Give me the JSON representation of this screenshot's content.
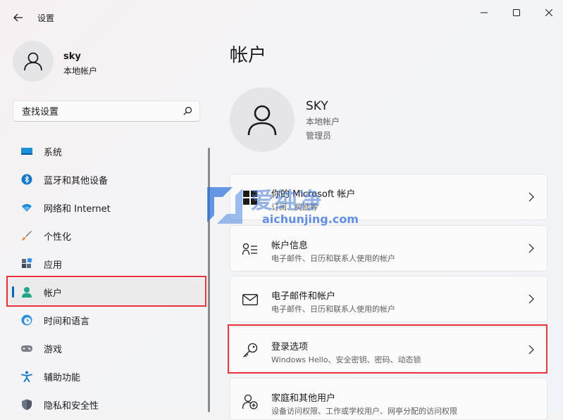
{
  "app": {
    "title": "设置"
  },
  "profile": {
    "name": "sky",
    "type": "本地帐户"
  },
  "search": {
    "placeholder": "查找设置"
  },
  "nav": {
    "items": [
      {
        "label": "系统",
        "icon": "monitor-icon"
      },
      {
        "label": "蓝牙和其他设备",
        "icon": "bluetooth-icon"
      },
      {
        "label": "网络和 Internet",
        "icon": "wifi-icon"
      },
      {
        "label": "个性化",
        "icon": "brush-icon"
      },
      {
        "label": "应用",
        "icon": "apps-icon"
      },
      {
        "label": "帐户",
        "icon": "person-icon",
        "active": true
      },
      {
        "label": "时间和语言",
        "icon": "globe-clock-icon"
      },
      {
        "label": "游戏",
        "icon": "gamepad-icon"
      },
      {
        "label": "辅助功能",
        "icon": "accessibility-icon"
      },
      {
        "label": "隐私和安全性",
        "icon": "shield-icon"
      }
    ]
  },
  "main": {
    "title": "帐户",
    "account": {
      "name": "SKY",
      "type": "本地帐户",
      "role": "管理员"
    },
    "cards": [
      {
        "title": "你的 Microsoft 帐户",
        "subtitle": "订阅、奖励等",
        "icon": "microsoft-logo-icon"
      },
      {
        "title": "帐户信息",
        "subtitle": "电子邮件、日历和联系人使用的帐户",
        "icon": "account-info-icon"
      },
      {
        "title": "电子邮件和帐户",
        "subtitle": "电子邮件、日历和联系人使用的帐户",
        "icon": "mail-icon"
      },
      {
        "title": "登录选项",
        "subtitle": "Windows Hello、安全密钥、密码、动态锁",
        "icon": "key-icon"
      },
      {
        "title": "家庭和其他用户",
        "subtitle": "设备访问权限、工作或学校用户、网亭分配的访问权限",
        "icon": "family-icon"
      }
    ]
  },
  "watermark": {
    "brand": "爱纯净",
    "url": "aichunjing.com"
  },
  "colors": {
    "accent": "#0067c0",
    "highlight": "#e8333c"
  }
}
